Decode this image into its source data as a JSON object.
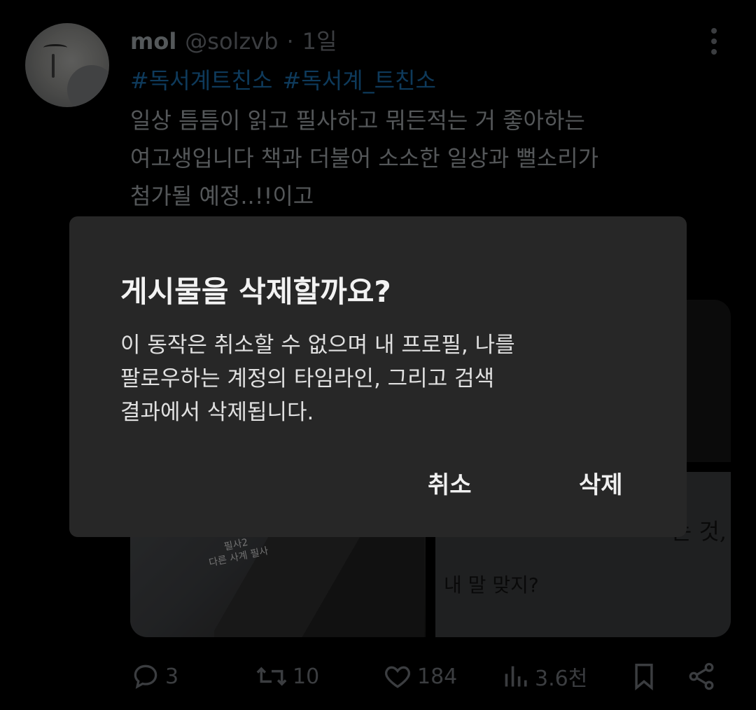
{
  "tweet": {
    "name": "mol",
    "handle": "@solzvb",
    "separator": "·",
    "time": "1일",
    "hashtags": [
      "#독서계트친소",
      "#독서계_트친소"
    ],
    "body": [
      "일상 틈틈이 읽고 필사하고 뭐든적는 거 좋아하는",
      "여고생입니다 책과 더불어 소소한 일상과 뻘소리가",
      "첨가될 예정..!!이고"
    ],
    "image_text": {
      "bottom_right_line1": "는 것,",
      "bottom_right_line2": "내 말 맞지?",
      "handwriting": "필사2\n다른 사계 필사"
    },
    "actions": {
      "replies": "3",
      "reposts": "10",
      "likes": "184",
      "views": "3.6천"
    }
  },
  "dialog": {
    "title": "게시물을 삭제할까요?",
    "message_lines": [
      "이 동작은 취소할 수 없으며 내 프로필, 나를",
      "팔로우하는 계정의 타임라인, 그리고 검색",
      "결과에서 삭제됩니다."
    ],
    "cancel_label": "취소",
    "delete_label": "삭제"
  },
  "colors": {
    "background": "#000000",
    "dialog_bg": "#272727",
    "hashtag": "#1d9bf0",
    "muted": "#71767b"
  }
}
